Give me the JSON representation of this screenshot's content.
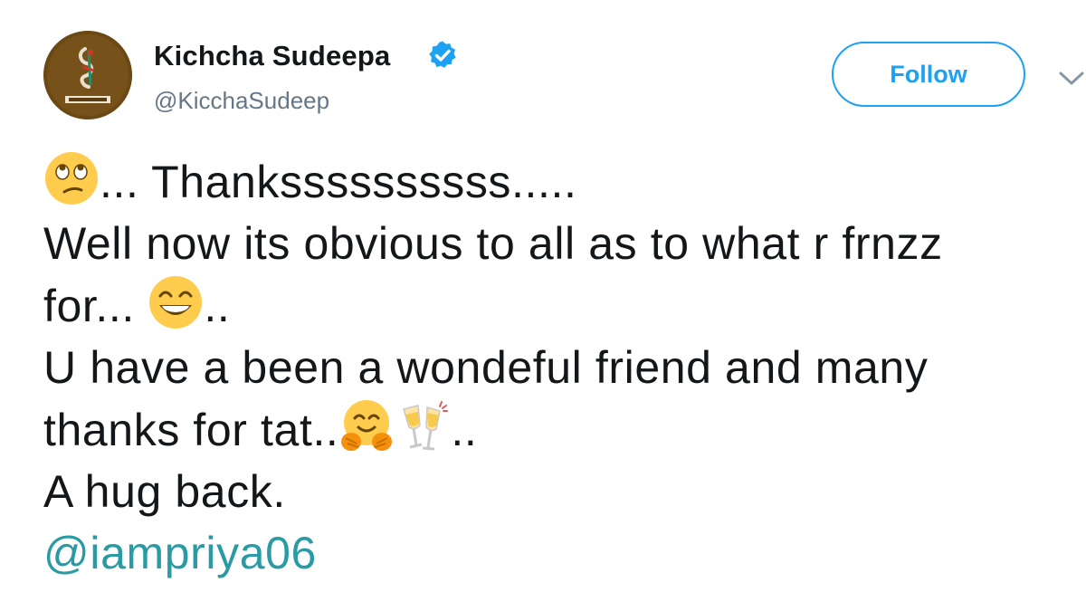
{
  "author": {
    "display_name": "Kichcha Sudeepa",
    "handle": "@KicchaSudeep",
    "verified": true,
    "avatar_icon": "kichcha-logo-avatar"
  },
  "actions": {
    "follow_label": "Follow",
    "menu_icon": "chevron-down-icon"
  },
  "tweet": {
    "line1": "... Thankssssssssss.....",
    "line2": "Well now its obvious to all as to what r frnzz",
    "line3_text": "for... ",
    "line3_tail": "..",
    "line4": "U have a been a wondeful friend and  many",
    "line5_text": "thanks for tat..",
    "line5_tail": "..",
    "line6": "A hug back.",
    "mention": "@iampriya06",
    "emojis": {
      "eye_roll": "face-with-rolling-eyes-emoji",
      "grin": "grinning-face-with-smiling-eyes-emoji",
      "hug": "hugging-face-emoji",
      "cheers": "clinking-glasses-emoji"
    }
  },
  "colors": {
    "accent": "#1da1f2",
    "mention": "#2a9aa5",
    "verified": "#1da1f2",
    "text": "#14171a",
    "secondary_text": "#657786"
  }
}
